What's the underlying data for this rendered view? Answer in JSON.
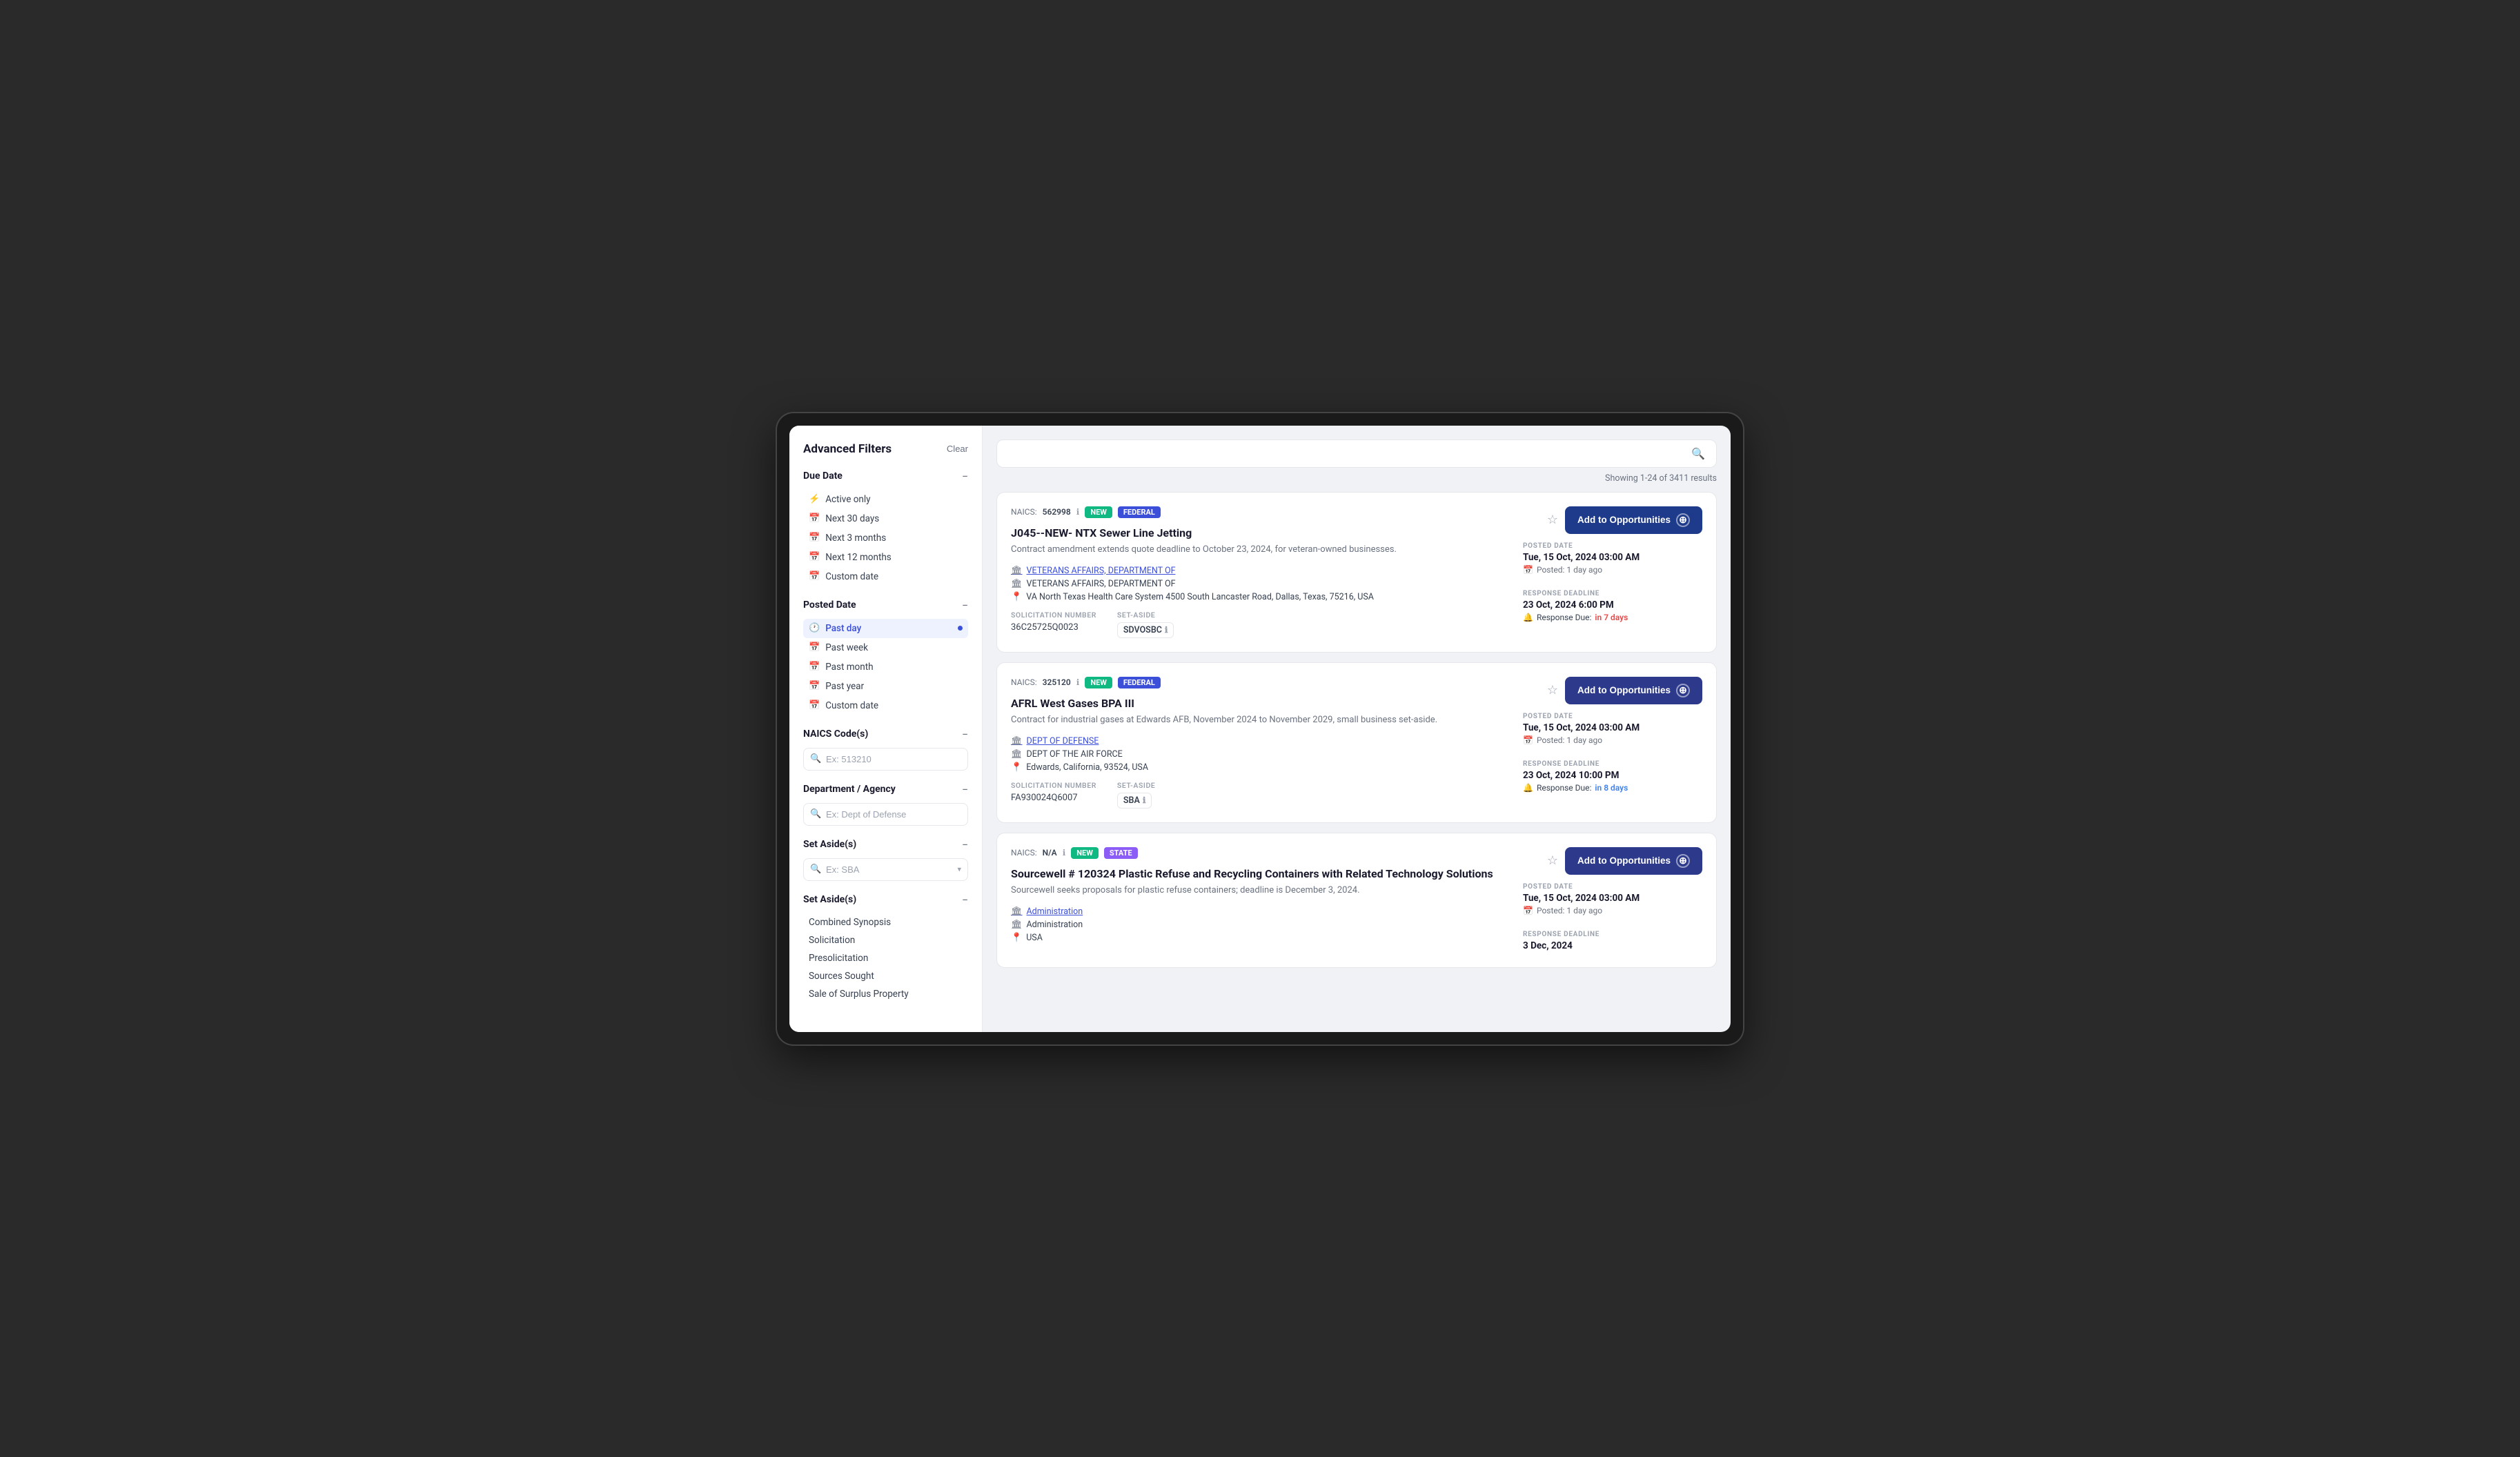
{
  "sidebar": {
    "title": "Advanced Filters",
    "clear_label": "Clear",
    "due_date": {
      "label": "Due Date",
      "items": [
        {
          "label": "Active only",
          "icon": "⚡",
          "active": false
        },
        {
          "label": "Next 30 days",
          "icon": "📅",
          "active": false
        },
        {
          "label": "Next 3 months",
          "icon": "📅",
          "active": false
        },
        {
          "label": "Next 12 months",
          "icon": "📅",
          "active": false
        },
        {
          "label": "Custom date",
          "icon": "📅",
          "active": false
        }
      ]
    },
    "posted_date": {
      "label": "Posted Date",
      "items": [
        {
          "label": "Past day",
          "icon": "🕐",
          "active": true
        },
        {
          "label": "Past week",
          "icon": "📅",
          "active": false
        },
        {
          "label": "Past month",
          "icon": "📅",
          "active": false
        },
        {
          "label": "Past year",
          "icon": "📅",
          "active": false
        },
        {
          "label": "Custom date",
          "icon": "📅",
          "active": false
        }
      ]
    },
    "naics_code": {
      "label": "NAICS Code(s)",
      "placeholder": "Ex: 513210"
    },
    "department_agency": {
      "label": "Department / Agency",
      "placeholder": "Ex: Dept of Defense"
    },
    "set_asides_input": {
      "label": "Set Aside(s)",
      "placeholder": "Ex: SBA"
    },
    "set_asides_list": {
      "label": "Set Aside(s)",
      "items": [
        {
          "label": "Combined Synopsis"
        },
        {
          "label": "Solicitation"
        },
        {
          "label": "Presolicitation"
        },
        {
          "label": "Sources Sought"
        },
        {
          "label": "Sale of Surplus Property"
        }
      ]
    }
  },
  "search": {
    "placeholder": "",
    "results_text": "Showing 1-24 of 3411 results"
  },
  "opportunities": [
    {
      "naics_label": "NAICS:",
      "naics_value": "562998",
      "badge_new": "NEW",
      "badge_type": "Federal",
      "badge_type_class": "federal",
      "title": "J045--NEW- NTX Sewer Line Jetting",
      "description": "Contract amendment extends quote deadline to October 23, 2024, for veteran-owned businesses.",
      "org_link": "VETERANS AFFAIRS, DEPARTMENT OF",
      "org_sub": "VETERANS AFFAIRS, DEPARTMENT OF",
      "location": "VA North Texas Health Care System 4500 South Lancaster Road, Dallas, Texas, 75216, USA",
      "sol_label": "SOLICITATION NUMBER",
      "sol_value": "36C25725Q0023",
      "set_aside_label": "SET-ASIDE",
      "set_aside_value": "SDVOSBC",
      "posted_label": "POSTED DATE",
      "posted_date": "Tue, 15 Oct, 2024 03:00 AM",
      "posted_ago": "Posted:  1 day ago",
      "deadline_label": "RESPONSE DEADLINE",
      "deadline_date": "23 Oct, 2024 6:00 PM",
      "deadline_due": "Response Due:  in 7 days",
      "deadline_color": "red",
      "add_label": "Add to Opportunities"
    },
    {
      "naics_label": "NAICS:",
      "naics_value": "325120",
      "badge_new": "NEW",
      "badge_type": "Federal",
      "badge_type_class": "federal",
      "title": "AFRL West Gases BPA III",
      "description": "Contract for industrial gases at Edwards AFB, November 2024 to November 2029, small business set-aside.",
      "org_link": "DEPT OF DEFENSE",
      "org_sub": "DEPT OF THE AIR FORCE",
      "location": "Edwards, California, 93524, USA",
      "sol_label": "SOLICITATION NUMBER",
      "sol_value": "FA930024Q6007",
      "set_aside_label": "SET-ASIDE",
      "set_aside_value": "SBA",
      "posted_label": "POSTED DATE",
      "posted_date": "Tue, 15 Oct, 2024 03:00 AM",
      "posted_ago": "Posted:  1 day ago",
      "deadline_label": "RESPONSE DEADLINE",
      "deadline_date": "23 Oct, 2024 10:00 PM",
      "deadline_due": "Response Due:  in 8 days",
      "deadline_color": "blue",
      "add_label": "Add to Opportunities"
    },
    {
      "naics_label": "NAICS:",
      "naics_value": "N/A",
      "badge_new": "NEW",
      "badge_type": "State",
      "badge_type_class": "state",
      "title": "Sourcewell # 120324 Plastic Refuse and Recycling Containers with Related Technology Solutions",
      "description": "Sourcewell seeks proposals for plastic refuse containers; deadline is December 3, 2024.",
      "org_link": "Administration",
      "org_sub": "Administration",
      "location": "USA",
      "sol_label": "",
      "sol_value": "",
      "set_aside_label": "",
      "set_aside_value": "",
      "posted_label": "POSTED DATE",
      "posted_date": "Tue, 15 Oct, 2024 03:00 AM",
      "posted_ago": "Posted:  1 day ago",
      "deadline_label": "RESPONSE DEADLINE",
      "deadline_date": "3 Dec, 2024",
      "deadline_due": "",
      "deadline_color": "blue",
      "add_label": "Add to Opportunities"
    }
  ]
}
